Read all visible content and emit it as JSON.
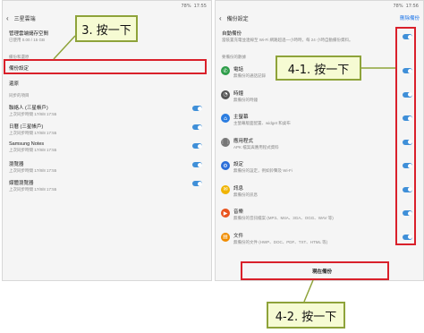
{
  "left": {
    "status": {
      "time": "17:55",
      "battery": "78%"
    },
    "title": "三星雲端",
    "items": [
      {
        "title": "管理雲端儲存空間",
        "sub": "已使用 0.00 / 15 GB"
      },
      {
        "section": "備份和還原"
      },
      {
        "title": "備份設定",
        "sub": ""
      },
      {
        "title": "還原",
        "sub": ""
      },
      {
        "section": "同步的項目"
      },
      {
        "title": "聯絡人 (三星帳戶)",
        "sub": "上次同步時間 17/8/8 17:55",
        "toggle": true
      },
      {
        "title": "日曆 (三星帳戶)",
        "sub": "上次同步時間 17/8/8 17:55",
        "toggle": true
      },
      {
        "title": "Samsung Notes",
        "sub": "上次同步時間 17/8/8 17:55",
        "toggle": true
      },
      {
        "title": "瀏覽器",
        "sub": "上次同步時間 17/8/8 17:55",
        "toggle": true
      },
      {
        "title": "媒體瀏覽器",
        "sub": "上次同步時間 17/8/8 17:55",
        "toggle": true
      }
    ]
  },
  "right": {
    "status": {
      "time": "17:56",
      "battery": "78%"
    },
    "title": "備份設定",
    "action": "刪除備份",
    "auto": {
      "title": "自動備份",
      "sub": "當裝置充電並連線至 Wi-Fi 網路超過一小時時，每 24 小時自動備份資料。"
    },
    "section": "要備份的數據",
    "items": [
      {
        "title": "電話",
        "sub": "無備份的通話記錄",
        "icon": "phone-icon",
        "glyph": "✆",
        "color": "#2e9d4a"
      },
      {
        "title": "時鐘",
        "sub": "無備份的時鐘",
        "icon": "clock-icon",
        "glyph": "◔",
        "color": "#555555"
      },
      {
        "title": "主螢幕",
        "sub": "主螢幕版面配置、widget 和桌布",
        "icon": "home-icon",
        "glyph": "⌂",
        "color": "#2b7de0"
      },
      {
        "title": "應用程式",
        "sub": "APK 檔案與應用程式資料",
        "icon": "apps-icon",
        "glyph": "⋮⋮",
        "color": "#777777"
      },
      {
        "title": "設定",
        "sub": "無備份的設定，例如鈴聲及 Wi-Fi",
        "icon": "settings-icon",
        "glyph": "⚙",
        "color": "#2b6ed9"
      },
      {
        "title": "訊息",
        "sub": "無備份的訊息",
        "icon": "message-icon",
        "glyph": "✉",
        "color": "#f0b400"
      },
      {
        "title": "音樂",
        "sub": "無備份的音訊檔案 (MP3、M4A、3GA、OGG、WAV 等)",
        "icon": "music-icon",
        "glyph": "▶",
        "color": "#e8541e"
      },
      {
        "title": "文件",
        "sub": "無備份的文件 (HWP、DOC、PDF、TXT、HTML 等)",
        "icon": "document-icon",
        "glyph": "▤",
        "color": "#f08c00"
      }
    ],
    "button": "現在備份"
  },
  "callouts": {
    "step3": "3. 按一下",
    "step41": "4-1. 按一下",
    "step42": "4-2. 按一下"
  },
  "colors": {
    "toggle": "#3f8fd8",
    "highlight": "#d9202a",
    "callout_border": "#8ea33a",
    "callout_bg": "#f6fbd3"
  }
}
